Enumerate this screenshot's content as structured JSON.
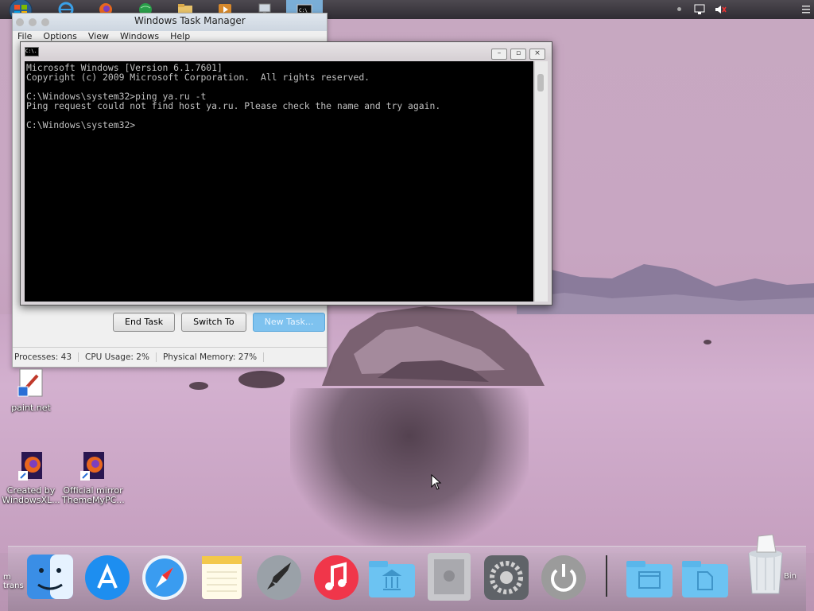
{
  "taskbar": {
    "start_orb": "windows-start-orb",
    "pinned": [
      "ie-icon",
      "firefox-icon",
      "globe-icon",
      "folder-icon",
      "media-player-icon",
      "network-icon",
      "cmd-icon"
    ],
    "tray": [
      "network-tray-icon",
      "volume-muted-icon"
    ]
  },
  "task_manager": {
    "title": "Windows Task Manager",
    "menu": [
      "File",
      "Options",
      "View",
      "Windows",
      "Help"
    ],
    "buttons": {
      "end_task": "End Task",
      "switch_to": "Switch To",
      "new_task": "New Task..."
    },
    "status": {
      "processes": "Processes: 43",
      "cpu": "CPU Usage: 2%",
      "memory": "Physical Memory: 27%"
    }
  },
  "cmd": {
    "icon_label": "C:\\.",
    "lines": [
      "Microsoft Windows [Version 6.1.7601]",
      "Copyright (c) 2009 Microsoft Corporation.  All rights reserved.",
      "",
      "C:\\Windows\\system32>ping ya.ru -t",
      "Ping request could not find host ya.ru. Please check the name and try again.",
      "",
      "C:\\Windows\\system32>"
    ]
  },
  "desktop_icons": [
    {
      "label": "paint.net",
      "icon": "paintnet-icon"
    },
    {
      "label": "Created by WindowsXL...",
      "icon": "firefox-shortcut-icon"
    },
    {
      "label": "Official mirror ThemeMyPC...",
      "icon": "firefox-shortcut-icon"
    }
  ],
  "dock": {
    "items": [
      "finder-icon",
      "app-store-icon",
      "safari-icon",
      "notes-icon",
      "launchpad-icon",
      "itunes-icon",
      "library-folder-icon",
      "mac-pro-icon",
      "system-preferences-icon",
      "power-icon",
      "window-folder-icon",
      "documents-folder-icon",
      "trash-icon"
    ],
    "left_label": "m trans",
    "trash_label": "Bin"
  },
  "colors": {
    "accent": "#7ec2ef",
    "cmd_bg": "#000000",
    "cmd_text": "#c0c0c0"
  }
}
